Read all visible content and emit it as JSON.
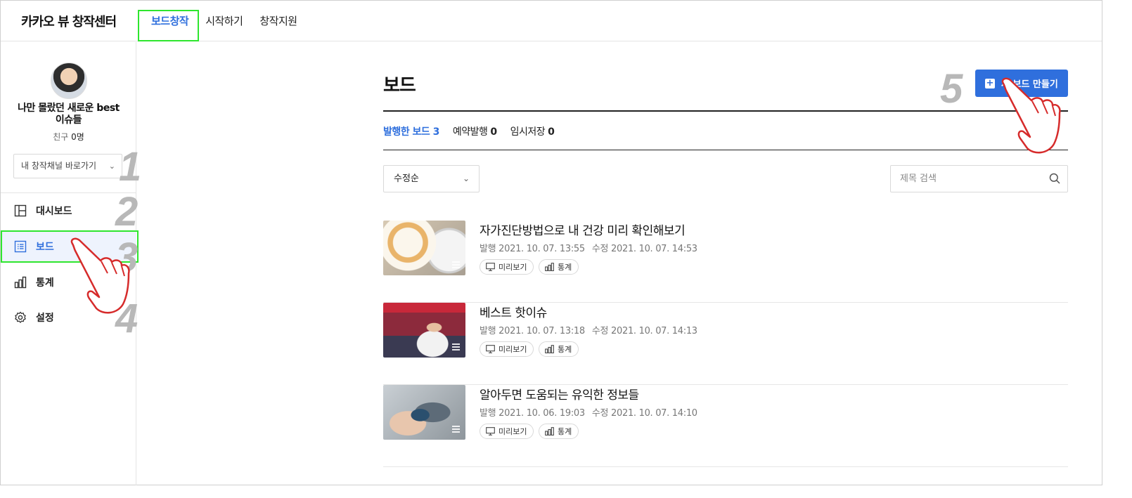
{
  "header": {
    "logo": "카카오 뷰 창작센터",
    "tabs": [
      {
        "label": "보드창작"
      },
      {
        "label": "시작하기"
      },
      {
        "label": "창작지원"
      }
    ]
  },
  "sidebar": {
    "profile_name": "나만 몰랐던 새로운 best\n이슈들",
    "friends_label": "친구",
    "friends_count": "0명",
    "channel_select": "내 창작채널 바로가기",
    "items": [
      {
        "label": "대시보드",
        "icon": "dashboard-icon"
      },
      {
        "label": "보드",
        "icon": "board-list-icon"
      },
      {
        "label": "통계",
        "icon": "stats-icon"
      },
      {
        "label": "설정",
        "icon": "gear-icon"
      }
    ]
  },
  "steps": [
    "1",
    "2",
    "3",
    "4",
    "5"
  ],
  "main": {
    "title": "보드",
    "new_board_button": "새 보드 만들기",
    "filters": [
      {
        "label": "발행한 보드",
        "count": "3"
      },
      {
        "label": "예약발행",
        "count": "0"
      },
      {
        "label": "임시저장",
        "count": "0"
      }
    ],
    "sort": "수정순",
    "search_placeholder": "제목 검색",
    "preview_label": "미리보기",
    "stats_label": "통계",
    "boards": [
      {
        "title": "자가진단방법으로 내 건강 미리 확인해보기",
        "published": "발행 2021. 10. 07. 13:55",
        "modified": "수정 2021. 10. 07. 14:53"
      },
      {
        "title": "베스트 핫이슈",
        "published": "발행 2021. 10. 07. 13:18",
        "modified": "수정 2021. 10. 07. 14:13"
      },
      {
        "title": "알아두면 도움되는 유익한 정보들",
        "published": "발행 2021. 10. 06. 19:03",
        "modified": "수정 2021. 10. 07. 14:10"
      }
    ]
  },
  "colors": {
    "accent": "#2f6fdd",
    "highlight": "#2ee62e",
    "step": "#b8b8b8"
  }
}
